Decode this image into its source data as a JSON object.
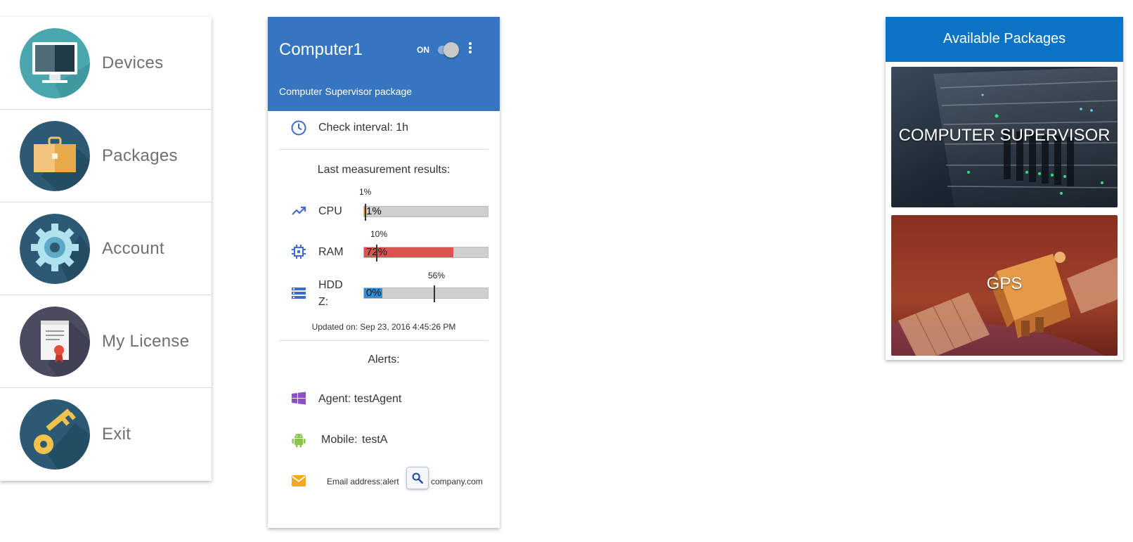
{
  "menu": {
    "items": [
      {
        "label": "Devices",
        "icon": "monitor-icon"
      },
      {
        "label": "Packages",
        "icon": "briefcase-icon"
      },
      {
        "label": "Account",
        "icon": "gear-icon"
      },
      {
        "label": "My License",
        "icon": "certificate-icon"
      },
      {
        "label": "Exit",
        "icon": "key-icon"
      }
    ]
  },
  "device_card": {
    "title": "Computer1",
    "toggle_label": "ON",
    "toggle_on": true,
    "subtitle": "Computer Supervisor package",
    "check_interval": "Check interval: 1h",
    "results_title": "Last measurement results:",
    "metrics": [
      {
        "label": "CPU",
        "value_text": "1%",
        "value": 1,
        "threshold_text": "1%",
        "threshold": 1,
        "bar_color": "#ec9f2e",
        "icon": "trending-up-icon"
      },
      {
        "label": "RAM",
        "value_text": "72%",
        "value": 72,
        "threshold_text": "10%",
        "threshold": 10,
        "bar_color": "#d9534f",
        "icon": "chip-icon"
      },
      {
        "label": "HDD Z:",
        "value_text": "0%",
        "value": 0,
        "threshold_text": "56%",
        "threshold": 56,
        "bar_color": "#2f8fd8",
        "icon": "storage-icon"
      }
    ],
    "updated": "Updated on: Sep 23, 2016 4:45:26 PM",
    "alerts_title": "Alerts:",
    "alerts": {
      "agent": "Agent: testAgent",
      "mobile_label": "Mobile:",
      "mobile_value": "testA",
      "email_prefix": "Email address:alert",
      "email_suffix": "company.com"
    }
  },
  "available_packages": {
    "title": "Available Packages",
    "items": [
      {
        "name": "COMPUTER SUPERVISOR"
      },
      {
        "name": "GPS"
      }
    ]
  },
  "colors": {
    "card_header": "#3676c0",
    "packages_header": "#0a73c4",
    "icon_blue": "#3f6bd1",
    "windows_purple": "#8e4fc0",
    "android_green": "#8bc34a",
    "mail_orange": "#f5a623"
  }
}
